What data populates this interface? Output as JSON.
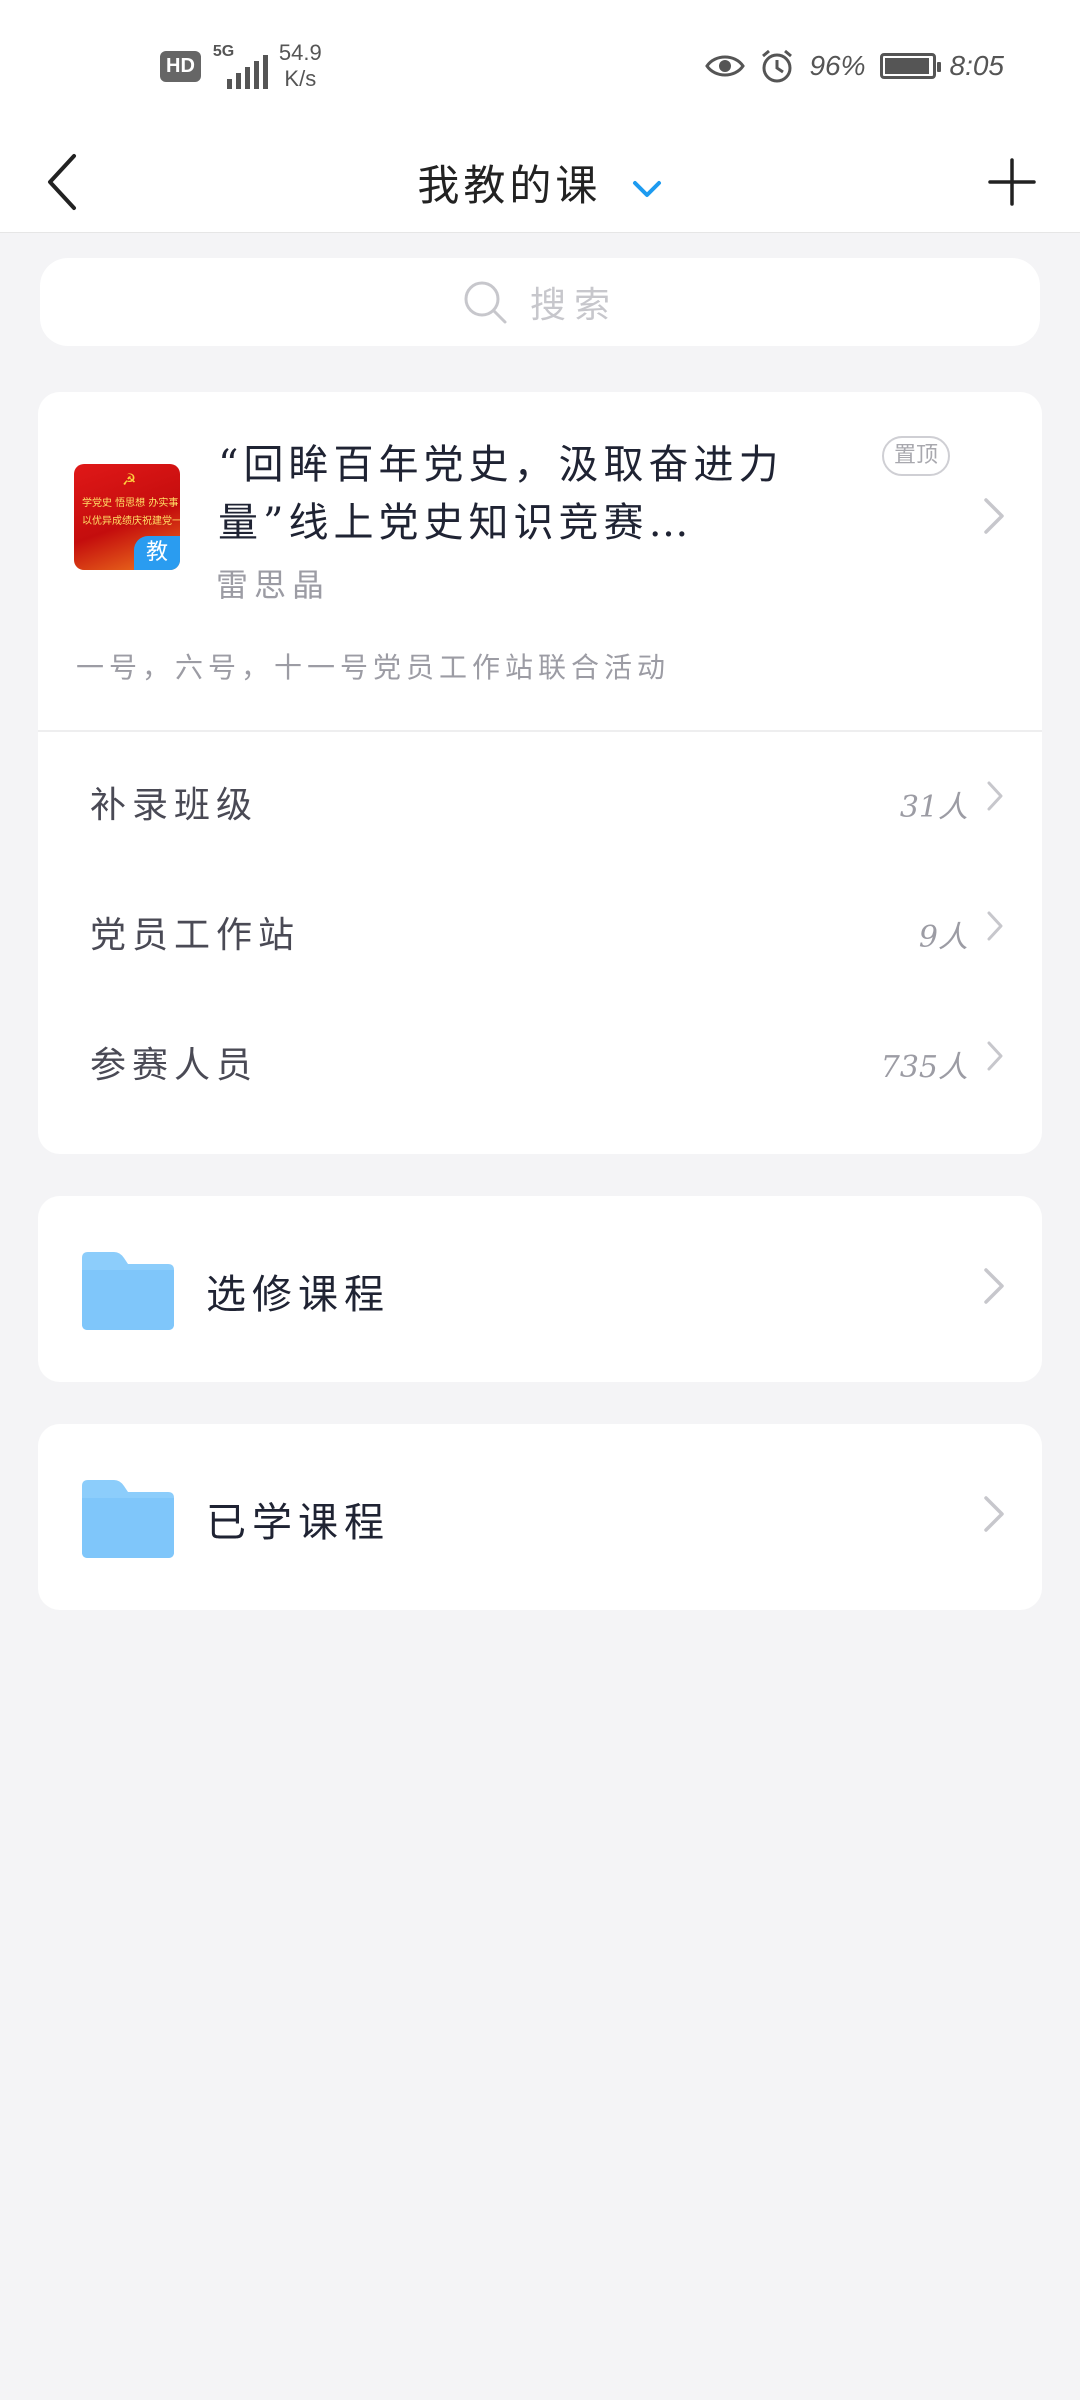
{
  "status_bar": {
    "hd": "HD",
    "network_type": "5G",
    "speed_value": "54.9",
    "speed_unit": "K/s",
    "battery_percent": "96%",
    "battery_level": 0.96,
    "time": "8:05",
    "icons": [
      "eye-icon",
      "alarm-icon",
      "battery-icon"
    ]
  },
  "nav": {
    "title": "我教的课",
    "accent_color": "#1d9bf0"
  },
  "search": {
    "placeholder": "搜索"
  },
  "course": {
    "title": "“回眸百年党史，汲取奋进力量”线上党史知识竞赛…",
    "pin_label": "置顶",
    "teacher": "雷思晶",
    "description": "一号，六号，十一号党员工作站联合活动",
    "thumb_text_line1": "学党史 悟思想 办实事 开新局",
    "thumb_text_line2": "以优异成绩庆祝建党一百周年",
    "thumb_badge": "教",
    "classes": [
      {
        "name": "补录班级",
        "count": "31人"
      },
      {
        "name": "党员工作站",
        "count": "9人"
      },
      {
        "name": "参赛人员",
        "count": "735人"
      }
    ]
  },
  "folders": [
    {
      "label": "选修课程",
      "icon": "folder-icon"
    },
    {
      "label": "已学课程",
      "icon": "folder-icon"
    }
  ]
}
